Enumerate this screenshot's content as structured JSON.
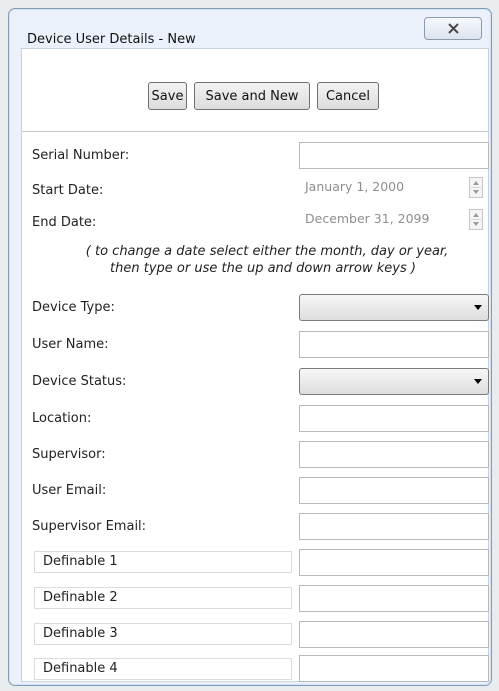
{
  "window": {
    "title": "Device User Details - New"
  },
  "toolbar": {
    "save_label": "Save",
    "save_new_label": "Save and New",
    "cancel_label": "Cancel"
  },
  "form": {
    "serial_number": {
      "label": "Serial Number:",
      "value": ""
    },
    "start_date": {
      "label": "Start Date:",
      "value": "January 1, 2000"
    },
    "end_date": {
      "label": "End Date:",
      "value": "December 31, 2099"
    },
    "hint_line1": "( to change a date select either the month, day or year,",
    "hint_line2": "then type or use the up and down arrow keys )",
    "device_type": {
      "label": "Device Type:",
      "value": ""
    },
    "user_name": {
      "label": "User Name:",
      "value": ""
    },
    "device_status": {
      "label": "Device Status:",
      "value": ""
    },
    "location": {
      "label": "Location:",
      "value": ""
    },
    "supervisor": {
      "label": "Supervisor:",
      "value": ""
    },
    "user_email": {
      "label": "User Email:",
      "value": ""
    },
    "supervisor_email": {
      "label": "Supervisor Email:",
      "value": ""
    },
    "definable": [
      {
        "label": "Definable 1",
        "value": ""
      },
      {
        "label": "Definable 2",
        "value": ""
      },
      {
        "label": "Definable 3",
        "value": ""
      },
      {
        "label": "Definable 4",
        "value": ""
      }
    ]
  }
}
